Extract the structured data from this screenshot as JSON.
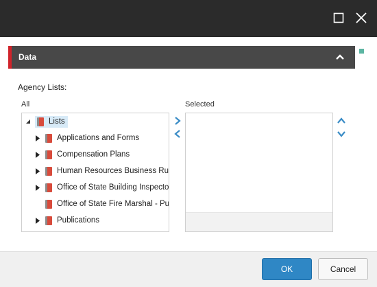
{
  "window": {
    "maximize_icon": "maximize-icon",
    "close_icon": "close-icon"
  },
  "section": {
    "title": "Data",
    "accent_color": "#d0232a"
  },
  "field": {
    "label": "Agency Lists:",
    "all_label": "All",
    "selected_label": "Selected"
  },
  "tree": {
    "root": "Lists",
    "items": [
      {
        "label": "Applications and Forms",
        "expandable": true
      },
      {
        "label": "Compensation Plans",
        "expandable": true
      },
      {
        "label": "Human Resources Business Rules",
        "expandable": true
      },
      {
        "label": "Office of State Building Inspector",
        "expandable": true
      },
      {
        "label": "Office of State Fire Marshal - Public",
        "expandable": false
      },
      {
        "label": "Publications",
        "expandable": true
      }
    ]
  },
  "selected": {
    "items": []
  },
  "footer": {
    "ok_label": "OK",
    "cancel_label": "Cancel",
    "ok_color": "#2f87c5"
  }
}
